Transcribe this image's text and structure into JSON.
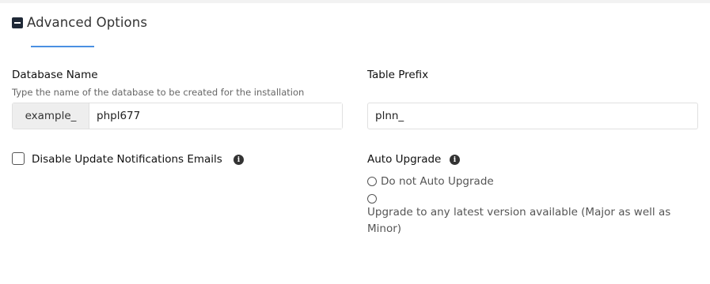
{
  "section": {
    "title": "Advanced Options"
  },
  "database": {
    "label": "Database Name",
    "hint": "Type the name of the database to be created for the installation",
    "prefix": "example_",
    "value": "phpl677"
  },
  "table_prefix": {
    "label": "Table Prefix",
    "value": "plnn_"
  },
  "update_notifications": {
    "label": "Disable Update Notifications Emails",
    "checked": false
  },
  "auto_upgrade": {
    "label": "Auto Upgrade",
    "options": [
      {
        "label": "Do not Auto Upgrade",
        "selected": false
      },
      {
        "label": "Upgrade to any latest version available (Major as well as Minor)",
        "selected": false
      }
    ]
  },
  "icons": {
    "info": "info-icon",
    "collapse": "minus-square-icon"
  }
}
